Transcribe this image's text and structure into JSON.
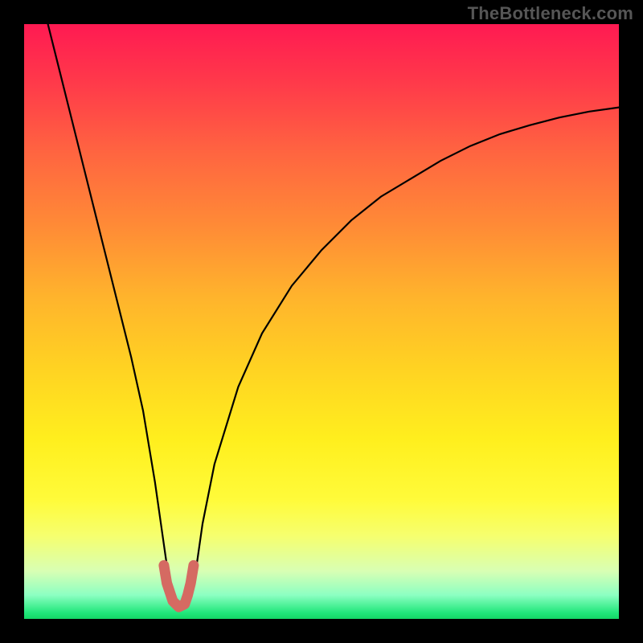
{
  "watermark": "TheBottleneck.com",
  "chart_data": {
    "type": "line",
    "title": "",
    "xlabel": "",
    "ylabel": "",
    "xlim": [
      0,
      100
    ],
    "ylim": [
      0,
      100
    ],
    "grid": false,
    "series": [
      {
        "name": "bottleneck-curve",
        "x": [
          4,
          6,
          8,
          10,
          12,
          14,
          16,
          18,
          20,
          22,
          23,
          24,
          25,
          26,
          27,
          28,
          29,
          30,
          32,
          36,
          40,
          45,
          50,
          55,
          60,
          65,
          70,
          75,
          80,
          85,
          90,
          95,
          100
        ],
        "values": [
          100,
          92,
          84,
          76,
          68,
          60,
          52,
          44,
          35,
          23,
          16,
          9,
          4,
          2,
          2,
          4,
          9,
          16,
          26,
          39,
          48,
          56,
          62,
          67,
          71,
          74,
          77,
          79.5,
          81.5,
          83,
          84.3,
          85.3,
          86
        ]
      },
      {
        "name": "optimum-marker",
        "x": [
          23.5,
          24,
          25,
          26,
          27,
          27.5,
          28,
          28.5
        ],
        "values": [
          9,
          6,
          3,
          2,
          2.5,
          4,
          6,
          9
        ]
      }
    ],
    "colors": {
      "curve": "#000000",
      "marker": "#d56a62"
    }
  }
}
